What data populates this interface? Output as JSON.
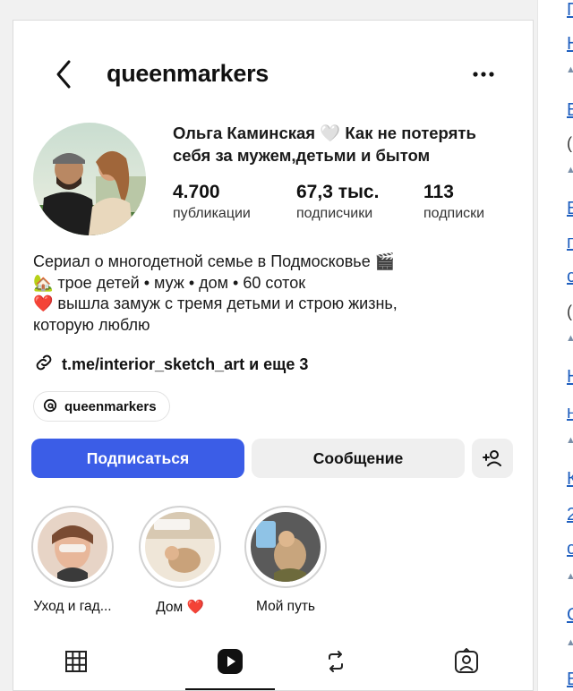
{
  "header": {
    "username": "queenmarkers",
    "back_icon": "chevron-left-icon",
    "more_icon": "more-horizontal-icon"
  },
  "profile": {
    "name_line1": "Ольга Каминская 🤍 Как не потерять",
    "name_line2": "себя за мужем,детьми и бытом",
    "stats": [
      {
        "value": "4.700",
        "label": "публикации"
      },
      {
        "value": "67,3 тыс.",
        "label": "подписчики"
      },
      {
        "value": "113",
        "label": "подписки"
      }
    ]
  },
  "bio": {
    "line1": "Сериал о многодетной семье в Подмосковье 🎬",
    "line2": "🏡 трое детей • муж • дом • 60 соток",
    "line3": "❤️ вышла замуж с тремя детьми и строю жизнь,",
    "line4": "которую люблю"
  },
  "link": {
    "text": "t.me/interior_sketch_art и еще 3",
    "icon": "link-icon"
  },
  "threads": {
    "label": "queenmarkers",
    "icon": "threads-icon"
  },
  "actions": {
    "follow_label": "Подписаться",
    "message_label": "Сообщение",
    "add_icon": "add-person-icon",
    "accent": "#3b5de7"
  },
  "highlights": [
    {
      "caption": "Уход и гад..."
    },
    {
      "caption": "Дом ❤️"
    },
    {
      "caption": "Мой путь"
    }
  ],
  "tabs": [
    {
      "icon": "grid-icon",
      "active": false
    },
    {
      "icon": "reels-icon",
      "active": true
    },
    {
      "icon": "repost-icon",
      "active": false
    },
    {
      "icon": "tagged-icon",
      "active": false
    }
  ]
}
